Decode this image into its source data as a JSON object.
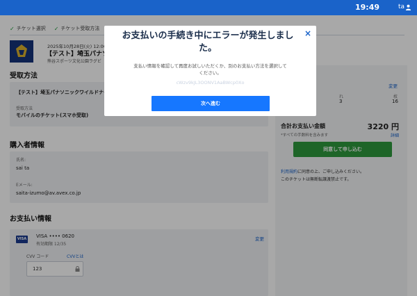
{
  "status_bar": {
    "time": "19:49",
    "user_name": "ta"
  },
  "steps": [
    {
      "label": "チケット選択"
    },
    {
      "label": "チケット受取方法"
    }
  ],
  "event": {
    "date": "2025年10月28日(火) 12:00",
    "title": "【テスト】埼玉パナソ",
    "venue": "熊谷スポーツ文化公園ラグビ"
  },
  "receive": {
    "heading": "受取方法",
    "ticket_name": "【テスト】埼玉パナソニックワイルドナイ",
    "method_label": "受取方法",
    "method_value": "モバイルのチケット(スマホ受取)"
  },
  "buyer": {
    "heading": "購入者情報",
    "name_label": "氏名:",
    "name_value": "sai ta",
    "email_label": "Eメール:",
    "email_value": "saita-izumo@av.avex.co.jp"
  },
  "payment": {
    "heading": "お支払い情報",
    "card_brand": "VISA",
    "card_number": "VISA •••• 0620",
    "expiry": "有効期限 12/35",
    "change_label": "変更",
    "cvv_label": "CVV コード",
    "cvv_help": "CVVとは",
    "cvv_value": "123"
  },
  "summary": {
    "change_label": "変更",
    "qty_labels": [
      "れ",
      "枚"
    ],
    "qty_values": [
      "3",
      "16"
    ],
    "total_label": "合計お支払い金額",
    "total_value": "3220 円",
    "fee_note": "*すべての手数料を含みます",
    "detail_link": "詳細",
    "apply_button": "同意して申し込む",
    "terms_link": "利用規約",
    "terms_text": "に同意の上、ご申し込みください。",
    "note": "このチケットは無断転譲渡禁止です。"
  },
  "modal": {
    "title": "お支払いの手続き中にエラーが発生しました。",
    "message": "支払い情報を確認して再度お試しいただくか、別のお支払い方法を選択してください。",
    "code": "cWzv9kJL3OONV1AaBWcp0Xo",
    "close_icon": "×",
    "next_button": "次へ進む"
  },
  "colors": {
    "topbar": "#1a63c9",
    "modal_title": "#1c2f4c",
    "primary_button": "#1677ff",
    "apply_button": "#2e9a3e",
    "link": "#1a63c9"
  },
  "icons": [
    "check-icon",
    "user-icon",
    "lock-icon",
    "close-icon",
    "team-logo"
  ]
}
